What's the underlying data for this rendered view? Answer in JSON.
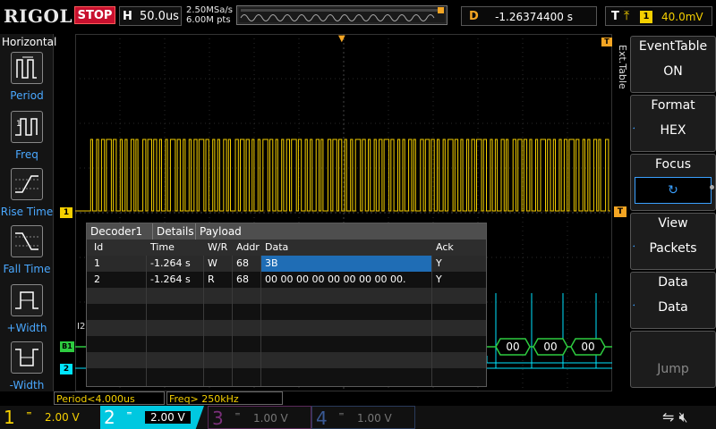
{
  "brand": "RIGOL",
  "run_state": "STOP",
  "horizontal": {
    "label": "H",
    "timebase": "50.0us"
  },
  "sample": {
    "rate": "2.50MSa/s",
    "points": "6.00M pts"
  },
  "delay": {
    "label": "D",
    "value": "-1.26374400 s"
  },
  "trigger": {
    "label": "T",
    "source": "1",
    "level": "40.0mV"
  },
  "left_menu": {
    "title": "Horizontal",
    "items": [
      {
        "label": "Period",
        "icon": "period-icon"
      },
      {
        "label": "Freq",
        "icon": "freq-icon"
      },
      {
        "label": "Rise Time",
        "icon": "rise-time-icon"
      },
      {
        "label": "Fall Time",
        "icon": "fall-time-icon"
      },
      {
        "label": "+Width",
        "icon": "pos-width-icon"
      },
      {
        "label": "-Width",
        "icon": "neg-width-icon"
      }
    ]
  },
  "right_menu": {
    "side_tab": "Ext.Table",
    "items": [
      {
        "title": "EventTable",
        "value": "ON"
      },
      {
        "title": "Format",
        "value": "HEX"
      },
      {
        "title": "Focus",
        "value": "↻"
      },
      {
        "title": "View",
        "value": "Packets"
      },
      {
        "title": "Data",
        "value": "Data"
      },
      {
        "title": "",
        "value": "Jump"
      }
    ]
  },
  "decoder": {
    "tabs": [
      "Decoder1",
      "Details",
      "Payload"
    ],
    "columns": [
      "Id",
      "Time",
      "W/R",
      "Addr",
      "Data",
      "Ack"
    ],
    "rows": [
      {
        "id": "1",
        "time": "-1.264 s",
        "wr": "W",
        "addr": "68",
        "data": "3B",
        "ack": "Y"
      },
      {
        "id": "2",
        "time": "-1.264 s",
        "wr": "R",
        "addr": "68",
        "data": "00 00 00 00 00 00 00 00 00.",
        "ack": "Y"
      }
    ]
  },
  "bus_labels": [
    "00",
    "00",
    "00"
  ],
  "bus_marker": "I2",
  "measure": {
    "period": "Period<4.000us",
    "freq": "Freq> 250kHz"
  },
  "channels": [
    {
      "num": "1",
      "scale": "2.00 V",
      "color": "#f5d000"
    },
    {
      "num": "2",
      "scale": "2.00 V",
      "color": "#00e5ff"
    },
    {
      "num": "3",
      "scale": "1.00 V",
      "color": "#c040c0"
    },
    {
      "num": "4",
      "scale": "1.00 V",
      "color": "#3a7bd5"
    }
  ],
  "markers": {
    "ch1": "1",
    "ch2": "2",
    "bus": "B1",
    "trig": "T"
  }
}
